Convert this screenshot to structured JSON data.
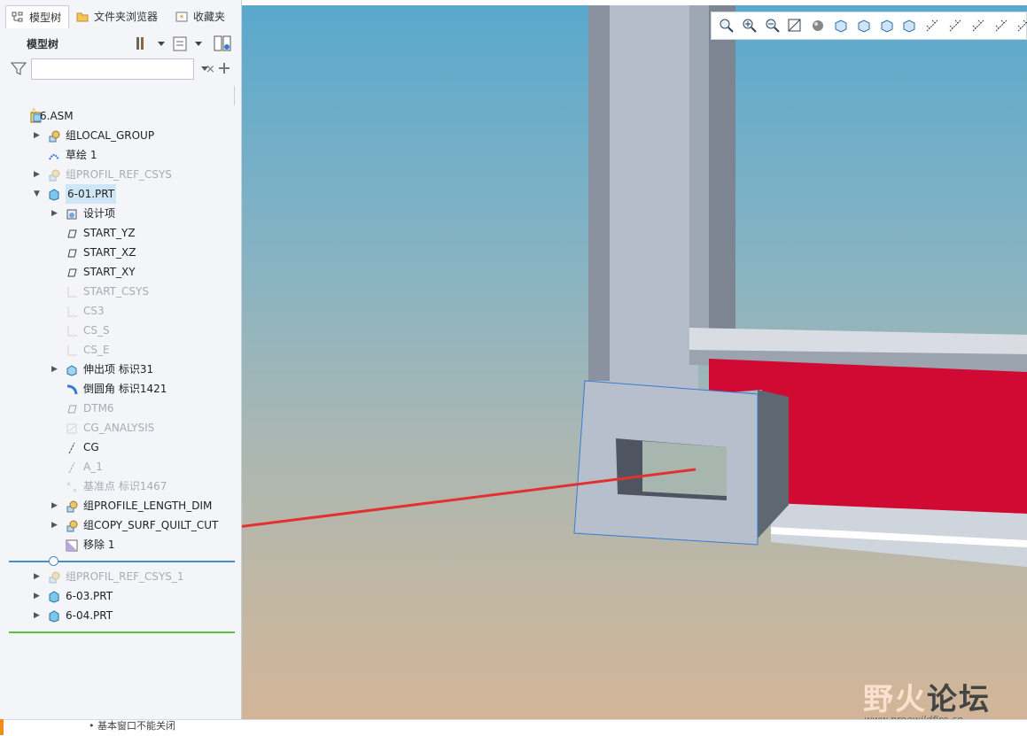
{
  "tabs": [
    {
      "label": "模型树",
      "active": true
    },
    {
      "label": "文件夹浏览器",
      "active": false
    },
    {
      "label": "收藏夹",
      "active": false
    }
  ],
  "tree_title": "模型树",
  "search": {
    "value": "",
    "clear_symbol": "×"
  },
  "tree": [
    {
      "label": "6.ASM",
      "badge": "⚠"
    },
    {
      "label": "组LOCAL_GROUP"
    },
    {
      "label": "草绘 1"
    },
    {
      "label": "组PROFIL_REF_CSYS"
    },
    {
      "label": "6-01.PRT"
    },
    {
      "label": "设计项"
    },
    {
      "label": "START_YZ"
    },
    {
      "label": "START_XZ"
    },
    {
      "label": "START_XY"
    },
    {
      "label": "START_CSYS"
    },
    {
      "label": "CS3"
    },
    {
      "label": "CS_S"
    },
    {
      "label": "CS_E"
    },
    {
      "label": "伸出项 标识31"
    },
    {
      "label": "倒圆角 标识1421"
    },
    {
      "label": "DTM6"
    },
    {
      "label": "CG_ANALYSIS"
    },
    {
      "label": "CG"
    },
    {
      "label": "A_1"
    },
    {
      "label": "基准点 标识1467"
    },
    {
      "label": "组PROFILE_LENGTH_DIM"
    },
    {
      "label": "组COPY_SURF_QUILT_CUT"
    },
    {
      "label": "移除 1"
    },
    {
      "label": "组PROFIL_REF_CSYS_1"
    },
    {
      "label": "6-03.PRT"
    },
    {
      "label": "6-04.PRT"
    }
  ],
  "status_message": "基本窗口不能关闭",
  "watermark": {
    "text_a": "野火",
    "text_b": "论坛",
    "url": "www.proewildfire.cn"
  },
  "colors": {
    "selection": "#cfe6f7",
    "insert_line": "#4a8bc9",
    "green_line": "#5fbf3f",
    "frame_red": "#d10a33",
    "arrow_red": "#e53030"
  }
}
